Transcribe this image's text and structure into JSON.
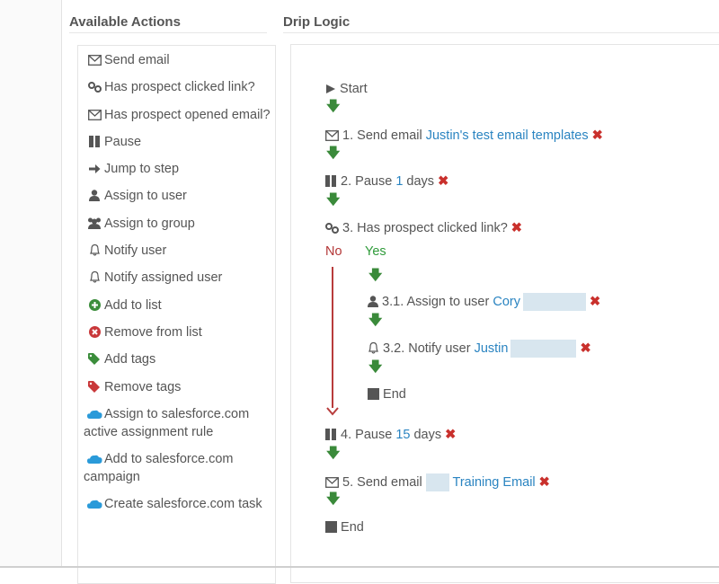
{
  "headings": {
    "actions": "Available Actions",
    "logic": "Drip Logic"
  },
  "actions": [
    {
      "icon": "envelope-icon",
      "label": "Send email"
    },
    {
      "icon": "link-icon",
      "label": "Has prospect clicked link?"
    },
    {
      "icon": "envelope-icon",
      "label": "Has prospect opened email?"
    },
    {
      "icon": "pause-icon",
      "label": "Pause"
    },
    {
      "icon": "arrow-right-icon",
      "label": "Jump to step"
    },
    {
      "icon": "user-icon",
      "label": "Assign to user"
    },
    {
      "icon": "group-icon",
      "label": "Assign to group"
    },
    {
      "icon": "bell-icon",
      "label": "Notify user"
    },
    {
      "icon": "bell-icon",
      "label": "Notify assigned user"
    },
    {
      "icon": "plus-circle-icon",
      "label": "Add to list"
    },
    {
      "icon": "remove-circle-icon",
      "label": "Remove from list"
    },
    {
      "icon": "tag-icon",
      "label": "Add tags"
    },
    {
      "icon": "tag-icon",
      "label": "Remove tags"
    },
    {
      "icon": "cloud-icon",
      "label": "Assign to salesforce.com active assignment rule"
    },
    {
      "icon": "cloud-icon",
      "label": "Add to salesforce.com campaign"
    },
    {
      "icon": "cloud-icon",
      "label": "Create salesforce.com task"
    }
  ],
  "logic": {
    "start": "Start",
    "step1": {
      "text": "1. Send email",
      "link": "Justin's test email templates"
    },
    "step2": {
      "text": "2. Pause",
      "value": "1",
      "unit": "days"
    },
    "step3": {
      "text": "3. Has prospect clicked link?",
      "no": "No",
      "yes": "Yes"
    },
    "step31": {
      "text": "3.1. Assign to user",
      "link": "Cory"
    },
    "step32": {
      "text": "3.2. Notify user",
      "link": "Justin"
    },
    "branch_end": "End",
    "step4": {
      "text": "4. Pause",
      "value": "15",
      "unit": "days"
    },
    "step5": {
      "text": "5. Send email",
      "link": "Training Email"
    },
    "end": "End",
    "delete_glyph": "✖",
    "down_glyph": "🡇"
  },
  "colors": {
    "link": "#2a84c1",
    "delete": "#c9302c",
    "yes": "#2f9b3a",
    "no": "#b33636",
    "arrow": "#3a8a3a"
  }
}
